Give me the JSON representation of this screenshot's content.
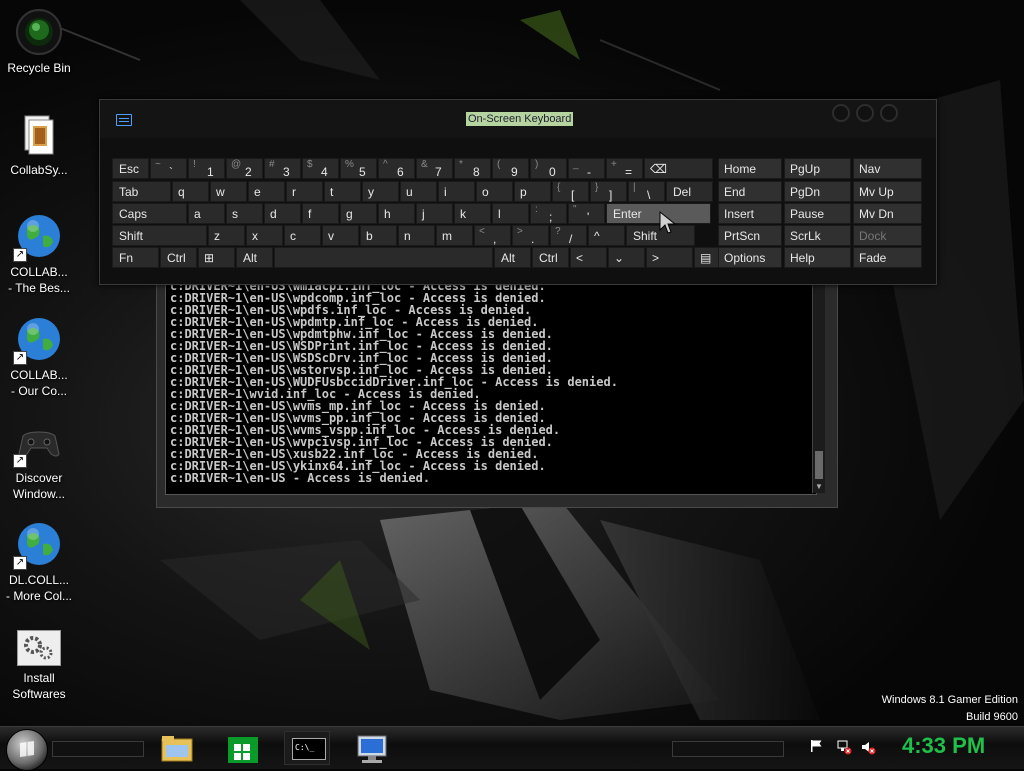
{
  "desktop_icons": [
    {
      "label": "Recycle Bin",
      "icon": "recycle-bin-icon"
    },
    {
      "label": "CollabSy...",
      "icon": "document-icon"
    },
    {
      "label": "COLLAB...\n- The Bes...",
      "icon": "globe-icon"
    },
    {
      "label": "COLLAB...\n- Our Co...",
      "icon": "globe-icon"
    },
    {
      "label": "Discover\nWindow...",
      "icon": "gamepad-icon"
    },
    {
      "label": "DL.COLL...\n- More Col...",
      "icon": "globe-icon"
    },
    {
      "label": "Install\nSoftwares",
      "icon": "gears-icon"
    }
  ],
  "osk": {
    "title": "On-Screen Keyboard"
  },
  "keys": {
    "row1": [
      {
        "main": "Esc"
      },
      {
        "alt": "~",
        "low": "`"
      },
      {
        "alt": "!",
        "low": "1"
      },
      {
        "alt": "@",
        "low": "2"
      },
      {
        "alt": "#",
        "low": "3"
      },
      {
        "alt": "$",
        "low": "4"
      },
      {
        "alt": "%",
        "low": "5"
      },
      {
        "alt": "^",
        "low": "6"
      },
      {
        "alt": "&",
        "low": "7"
      },
      {
        "alt": "*",
        "low": "8"
      },
      {
        "alt": "(",
        "low": "9"
      },
      {
        "alt": ")",
        "low": "0"
      },
      {
        "alt": "_",
        "low": "-"
      },
      {
        "alt": "+",
        "low": "="
      },
      {
        "main": "⌫"
      }
    ],
    "row2": [
      {
        "main": "Tab"
      },
      {
        "main": "q"
      },
      {
        "main": "w"
      },
      {
        "main": "e"
      },
      {
        "main": "r"
      },
      {
        "main": "t"
      },
      {
        "main": "y"
      },
      {
        "main": "u"
      },
      {
        "main": "i"
      },
      {
        "main": "o"
      },
      {
        "main": "p"
      },
      {
        "alt": "{",
        "low": "["
      },
      {
        "alt": "}",
        "low": "]"
      },
      {
        "alt": "|",
        "low": "\\"
      },
      {
        "main": "Del"
      }
    ],
    "row3": [
      {
        "main": "Caps"
      },
      {
        "main": "a"
      },
      {
        "main": "s"
      },
      {
        "main": "d"
      },
      {
        "main": "f"
      },
      {
        "main": "g"
      },
      {
        "main": "h"
      },
      {
        "main": "j"
      },
      {
        "main": "k"
      },
      {
        "main": "l"
      },
      {
        "alt": ":",
        "low": ";"
      },
      {
        "alt": "\"",
        "low": "'"
      },
      {
        "main": "Enter"
      }
    ],
    "row4": [
      {
        "main": "Shift"
      },
      {
        "main": "z"
      },
      {
        "main": "x"
      },
      {
        "main": "c"
      },
      {
        "main": "v"
      },
      {
        "main": "b"
      },
      {
        "main": "n"
      },
      {
        "main": "m"
      },
      {
        "alt": "<",
        "low": ","
      },
      {
        "alt": ">",
        "low": "."
      },
      {
        "alt": "?",
        "low": "/"
      },
      {
        "main": "^"
      },
      {
        "main": "Shift"
      }
    ],
    "row5": [
      {
        "main": "Fn"
      },
      {
        "main": "Ctrl"
      },
      {
        "main": "⊞"
      },
      {
        "main": "Alt"
      },
      {
        "main": ""
      },
      {
        "main": "Alt"
      },
      {
        "main": "Ctrl"
      },
      {
        "main": "<"
      },
      {
        "main": "⌄"
      },
      {
        "main": ">"
      },
      {
        "main": "▤"
      }
    ],
    "right_block": [
      [
        "Home",
        "PgUp",
        "Nav"
      ],
      [
        "End",
        "PgDn",
        "Mv Up"
      ],
      [
        "Insert",
        "Pause",
        "Mv Dn"
      ],
      [
        "PrtScn",
        "ScrLk",
        "Dock"
      ],
      [
        "Options",
        "Help",
        "Fade"
      ]
    ]
  },
  "console": {
    "lines": [
      "c:DRIVER~1\\en-US\\wmiacpi.inf_loc - Access is denied.",
      "c:DRIVER~1\\en-US\\wpdcomp.inf_loc - Access is denied.",
      "c:DRIVER~1\\en-US\\wpdfs.inf_loc - Access is denied.",
      "c:DRIVER~1\\en-US\\wpdmtp.inf_loc - Access is denied.",
      "c:DRIVER~1\\en-US\\wpdmtphw.inf_loc - Access is denied.",
      "c:DRIVER~1\\en-US\\WSDPrint.inf_loc - Access is denied.",
      "c:DRIVER~1\\en-US\\WSDScDrv.inf_loc - Access is denied.",
      "c:DRIVER~1\\en-US\\wstorvsp.inf_loc - Access is denied.",
      "c:DRIVER~1\\en-US\\WUDFUsbccidDriver.inf_loc - Access is denied.",
      "c:DRIVER~1\\wvid.inf_loc - Access is denied.",
      "c:DRIVER~1\\en-US\\wvms_mp.inf_loc - Access is denied.",
      "c:DRIVER~1\\en-US\\wvms_pp.inf_loc - Access is denied.",
      "c:DRIVER~1\\en-US\\wvms_vspp.inf_loc - Access is denied.",
      "c:DRIVER~1\\en-US\\wvpcivsp.inf_loc - Access is denied.",
      "c:DRIVER~1\\en-US\\xusb22.inf_loc - Access is denied.",
      "c:DRIVER~1\\en-US\\ykinx64.inf_loc - Access is denied.",
      "c:DRIVER~1\\en-US - Access is denied."
    ]
  },
  "watermark": {
    "line1": "Windows 8.1 Gamer Edition",
    "line2": "Build 9600"
  },
  "taskbar": {
    "apps": [
      {
        "name": "file-explorer-icon"
      },
      {
        "name": "store-icon"
      },
      {
        "name": "command-prompt-icon",
        "label": "C:\\_"
      },
      {
        "name": "remote-desktop-icon"
      }
    ],
    "clock": "4:33 PM",
    "tray": [
      "flag-icon",
      "network-icon",
      "volume-muted-icon"
    ]
  },
  "colors": {
    "clock_green": "#1fbf4a",
    "osk_key": "#2a2a2a",
    "osk_active": "#5a5a5a",
    "title_highlight": "#b6d4a0"
  }
}
